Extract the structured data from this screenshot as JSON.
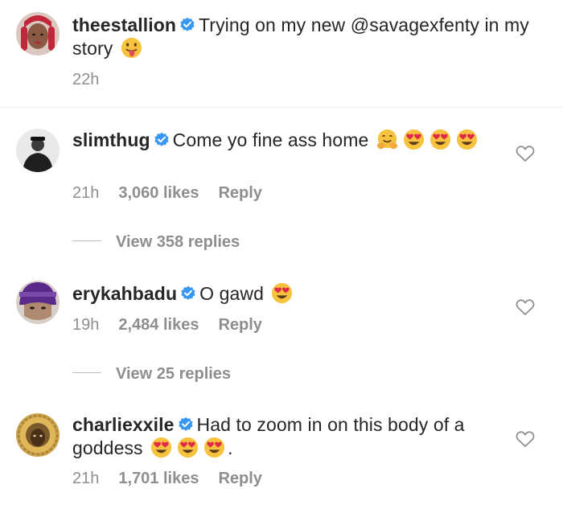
{
  "caption": {
    "username": "theestallion",
    "text_before": "Trying on my new ",
    "mention": "@savagexfenty",
    "text_after": " in my story",
    "time": "22h"
  },
  "comments": [
    {
      "username": "slimthug",
      "text": "Come yo fine ass home",
      "time": "21h",
      "likes": "3,060 likes",
      "reply": "Reply",
      "view_replies": "View 358 replies"
    },
    {
      "username": "erykahbadu",
      "text": "O gawd",
      "time": "19h",
      "likes": "2,484 likes",
      "reply": "Reply",
      "view_replies": "View 25 replies"
    },
    {
      "username": "charliexxile",
      "text": "Had to zoom in on this body of a goddess",
      "text_end": ".",
      "time": "21h",
      "likes": "1,701 likes",
      "reply": "Reply"
    }
  ],
  "icons": {
    "verified": "verified-badge-icon",
    "heart": "heart-outline-icon",
    "emoji_tongue": "face-with-tongue-emoji",
    "emoji_hug": "hugging-face-emoji",
    "emoji_heart_eyes": "heart-eyes-emoji"
  },
  "colors": {
    "verified_blue": "#3897f0",
    "meta_gray": "#8e8e8e",
    "text": "#262626"
  }
}
